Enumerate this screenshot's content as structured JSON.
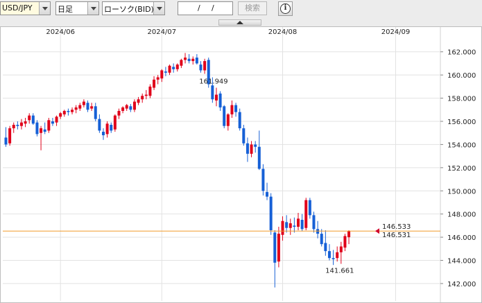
{
  "toolbar": {
    "pair": "USD/JPY",
    "period": "日足",
    "chart_type": "ローソク(BID)",
    "date_sep1": "/",
    "date_sep2": "/",
    "search_label": "検索",
    "info_icon": "info-icon",
    "info_glyph": "i"
  },
  "colors": {
    "up": "#e0001a",
    "down": "#1660d6",
    "current_line": "#f29b2a",
    "grid": "#e2e2e2",
    "high_label": "#d1002a",
    "low_label": "#1a84c8",
    "ask_label": "#d1002a",
    "bid_label": "#2040c0"
  },
  "chart_data": {
    "type": "candlestick",
    "x_labels": [
      "2024/06",
      "2024/07",
      "2024/08",
      "2024/09"
    ],
    "x_label_index": [
      14,
      40,
      71,
      100
    ],
    "ylim": [
      140.5,
      163.3
    ],
    "y_ticks": [
      142,
      144,
      146,
      148,
      150,
      152,
      154,
      156,
      158,
      160,
      162
    ],
    "y_tick_labels": [
      "142.000",
      "144.000",
      "146.000",
      "148.000",
      "150.000",
      "152.000",
      "154.000",
      "156.000",
      "158.000",
      "160.000",
      "162.000"
    ],
    "high_label": "161.949",
    "low_label": "141.661",
    "high_index": 54,
    "low_index": 86,
    "current_ask": "146.533",
    "current_bid": "146.531",
    "current_value": 146.53,
    "grid": true,
    "candles": [
      [
        154.6,
        155.5,
        153.8,
        154.0
      ],
      [
        154.1,
        155.6,
        153.9,
        155.4
      ],
      [
        155.4,
        155.9,
        155.0,
        155.7
      ],
      [
        155.7,
        156.0,
        155.3,
        155.6
      ],
      [
        155.6,
        156.2,
        155.3,
        155.9
      ],
      [
        155.8,
        156.3,
        155.5,
        156.0
      ],
      [
        156.1,
        156.7,
        155.8,
        156.5
      ],
      [
        156.5,
        156.7,
        155.7,
        155.8
      ],
      [
        155.9,
        156.1,
        154.7,
        154.9
      ],
      [
        155.0,
        155.6,
        153.5,
        155.4
      ],
      [
        155.3,
        155.9,
        154.9,
        155.1
      ],
      [
        155.2,
        156.3,
        155.0,
        156.1
      ],
      [
        156.0,
        156.3,
        155.6,
        155.8
      ],
      [
        155.9,
        156.5,
        155.6,
        156.4
      ],
      [
        156.4,
        156.8,
        156.2,
        156.7
      ],
      [
        156.6,
        157.0,
        156.4,
        156.9
      ],
      [
        156.9,
        157.1,
        156.5,
        156.8
      ],
      [
        156.8,
        157.2,
        156.6,
        157.0
      ],
      [
        157.0,
        157.4,
        156.7,
        157.2
      ],
      [
        157.1,
        157.6,
        156.9,
        157.4
      ],
      [
        157.4,
        157.9,
        157.2,
        157.7
      ],
      [
        157.6,
        157.8,
        156.8,
        157.0
      ],
      [
        157.1,
        157.6,
        156.9,
        157.3
      ],
      [
        157.3,
        157.6,
        156.0,
        156.2
      ],
      [
        156.2,
        156.6,
        155.0,
        155.2
      ],
      [
        155.1,
        155.4,
        154.4,
        154.8
      ],
      [
        154.9,
        156.0,
        154.6,
        155.8
      ],
      [
        155.7,
        155.9,
        155.0,
        155.2
      ],
      [
        155.3,
        156.6,
        155.1,
        156.5
      ],
      [
        156.5,
        157.1,
        156.2,
        156.9
      ],
      [
        156.9,
        157.3,
        156.7,
        157.2
      ],
      [
        157.1,
        157.5,
        156.9,
        157.4
      ],
      [
        157.3,
        157.5,
        156.8,
        157.0
      ],
      [
        157.0,
        157.9,
        156.8,
        157.7
      ],
      [
        157.6,
        158.1,
        157.4,
        157.9
      ],
      [
        157.9,
        158.4,
        157.6,
        158.2
      ],
      [
        158.2,
        158.7,
        157.9,
        158.3
      ],
      [
        158.2,
        159.2,
        158.0,
        159.0
      ],
      [
        158.9,
        159.9,
        158.7,
        159.6
      ],
      [
        159.6,
        160.0,
        159.2,
        159.8
      ],
      [
        159.7,
        160.5,
        159.4,
        160.4
      ],
      [
        160.3,
        160.7,
        159.9,
        160.2
      ],
      [
        160.2,
        160.9,
        160.0,
        160.8
      ],
      [
        160.7,
        161.0,
        160.2,
        160.5
      ],
      [
        160.5,
        161.0,
        160.3,
        160.9
      ],
      [
        160.8,
        161.4,
        160.6,
        161.3
      ],
      [
        161.3,
        161.9,
        161.0,
        161.5
      ],
      [
        161.4,
        161.8,
        161.0,
        161.2
      ],
      [
        161.2,
        161.6,
        160.9,
        161.4
      ],
      [
        161.5,
        161.8,
        160.9,
        161.0
      ],
      [
        160.9,
        161.2,
        160.2,
        160.4
      ],
      [
        160.4,
        161.4,
        160.1,
        161.2
      ],
      [
        161.3,
        161.5,
        158.9,
        159.2
      ],
      [
        159.1,
        159.8,
        157.6,
        157.9
      ],
      [
        157.8,
        158.9,
        157.3,
        158.3
      ],
      [
        158.4,
        158.6,
        156.9,
        157.2
      ],
      [
        157.3,
        157.4,
        155.4,
        155.6
      ],
      [
        155.6,
        156.7,
        155.2,
        156.6
      ],
      [
        156.6,
        157.8,
        156.3,
        157.4
      ],
      [
        157.4,
        157.6,
        156.4,
        156.8
      ],
      [
        156.8,
        157.1,
        155.2,
        155.4
      ],
      [
        155.4,
        155.7,
        153.9,
        154.1
      ],
      [
        154.1,
        154.6,
        152.5,
        153.2
      ],
      [
        153.2,
        154.3,
        152.9,
        154.0
      ],
      [
        154.0,
        154.3,
        153.3,
        153.8
      ],
      [
        153.8,
        155.2,
        151.8,
        151.9
      ],
      [
        151.9,
        152.3,
        149.6,
        150.0
      ],
      [
        149.9,
        150.7,
        149.2,
        149.5
      ],
      [
        149.5,
        149.8,
        146.2,
        146.6
      ],
      [
        146.4,
        146.6,
        141.661,
        143.8
      ],
      [
        143.9,
        146.9,
        143.4,
        146.3
      ],
      [
        146.2,
        147.8,
        145.7,
        147.4
      ],
      [
        147.3,
        147.9,
        146.4,
        146.8
      ],
      [
        146.8,
        147.6,
        146.2,
        147.2
      ],
      [
        147.0,
        147.7,
        146.4,
        146.9
      ],
      [
        146.9,
        148.1,
        146.6,
        147.6
      ],
      [
        147.5,
        148.0,
        146.5,
        146.7
      ],
      [
        146.8,
        149.4,
        146.6,
        149.2
      ],
      [
        149.2,
        149.4,
        147.6,
        147.9
      ],
      [
        147.9,
        148.2,
        146.4,
        146.7
      ],
      [
        146.7,
        147.4,
        145.9,
        146.3
      ],
      [
        146.3,
        146.7,
        145.2,
        145.4
      ],
      [
        145.5,
        146.6,
        144.4,
        144.8
      ],
      [
        144.8,
        145.4,
        144.0,
        144.2
      ],
      [
        144.2,
        144.9,
        143.6,
        144.1
      ],
      [
        144.2,
        145.2,
        143.9,
        144.7
      ],
      [
        144.7,
        145.6,
        143.7,
        145.2
      ],
      [
        145.1,
        146.3,
        144.8,
        146.1
      ],
      [
        146.0,
        146.6,
        145.4,
        146.53
      ]
    ]
  }
}
